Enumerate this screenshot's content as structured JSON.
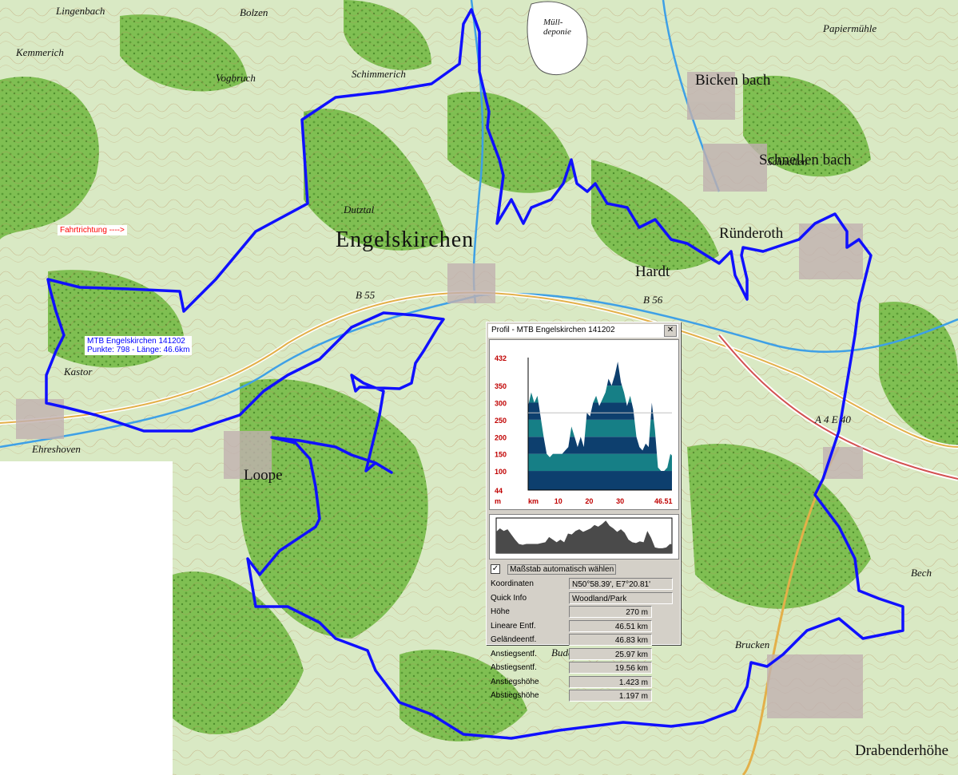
{
  "map": {
    "place_labels": [
      {
        "text": "Lingenbach",
        "cls": "lbl-sm"
      },
      {
        "text": "Bolzen",
        "cls": "lbl-sm"
      },
      {
        "text": "Müll-deponie",
        "cls": "lbl-sm"
      },
      {
        "text": "Papiermühle",
        "cls": "lbl-sm"
      },
      {
        "text": "Kemmerich",
        "cls": "lbl-sm"
      },
      {
        "text": "Vogbruch",
        "cls": "lbl-sm"
      },
      {
        "text": "Schimmerich",
        "cls": "lbl-sm"
      },
      {
        "text": "Bicken bach",
        "cls": "lbl-med"
      },
      {
        "text": "Schnellen bach",
        "cls": "lbl-med"
      },
      {
        "text": "Engelskirchen",
        "cls": "lbl-big"
      },
      {
        "text": "Ründeroth",
        "cls": "lbl-med"
      },
      {
        "text": "Hardt",
        "cls": "lbl-med"
      },
      {
        "text": "Dutztal",
        "cls": "lbl-sm"
      },
      {
        "text": "Loope",
        "cls": "lbl-med"
      },
      {
        "text": "Ehreshoven",
        "cls": "lbl-sm"
      },
      {
        "text": "Kastor",
        "cls": "lbl-sm"
      },
      {
        "text": "Brucken",
        "cls": "lbl-sm"
      },
      {
        "text": "Drabenderhöhe",
        "cls": "lbl-med"
      },
      {
        "text": "Buddelhagen",
        "cls": "lbl-sm"
      },
      {
        "text": "Bech",
        "cls": "lbl-sm"
      },
      {
        "text": "Schnellen",
        "cls": "lbl-sm"
      },
      {
        "text": "B 55",
        "cls": "lbl-sm"
      },
      {
        "text": "B 56",
        "cls": "lbl-sm"
      },
      {
        "text": "A 4 E 40",
        "cls": "lbl-sm"
      }
    ],
    "direction_label": "Fahrtrichtung ---->",
    "track_info_line1": "MTB Engelskirchen 141202",
    "track_info_line2": "Punkte: 798 - Länge: 46.6km",
    "track_color": "#1010ff"
  },
  "profile_window": {
    "title": "Profil - MTB Engelskirchen 141202",
    "close_label": "✕",
    "chart_data": {
      "type": "area",
      "y_ticks": [
        "432",
        "350",
        "300",
        "250",
        "200",
        "150",
        "100",
        "44"
      ],
      "y_unit": "m",
      "x_unit": "km",
      "x_ticks": [
        "10",
        "20",
        "30",
        "46.51"
      ],
      "ylim": [
        44,
        432
      ],
      "xlim": [
        0,
        46.51
      ],
      "guide_line": 270,
      "band_colors": [
        "#0d3f6e",
        "#167f86"
      ],
      "x": [
        0,
        1,
        2,
        3,
        4,
        5,
        6,
        7,
        8,
        9,
        10,
        11,
        12,
        13,
        14,
        15,
        16,
        17,
        18,
        19,
        20,
        21,
        22,
        23,
        24,
        25,
        26,
        27,
        28,
        29,
        30,
        31,
        32,
        33,
        34,
        35,
        36,
        37,
        38,
        39,
        40,
        41,
        42,
        43,
        44,
        45,
        46,
        46.51
      ],
      "values": [
        290,
        330,
        300,
        320,
        260,
        200,
        150,
        140,
        150,
        150,
        150,
        150,
        160,
        170,
        230,
        200,
        170,
        200,
        170,
        270,
        260,
        300,
        320,
        290,
        310,
        330,
        370,
        350,
        380,
        420,
        360,
        330,
        290,
        320,
        280,
        200,
        170,
        160,
        180,
        170,
        300,
        220,
        110,
        100,
        100,
        110,
        150,
        145
      ]
    },
    "checkbox": {
      "checked_mark": "✓",
      "label": "Maßstab automatisch wählen"
    },
    "fields": [
      {
        "key": "Koordinaten",
        "value": "N50°58.39', E7°20.81'",
        "align": "l"
      },
      {
        "key": "Quick Info",
        "value": "Woodland/Park",
        "align": "l"
      },
      {
        "key": "Höhe",
        "value": "270 m",
        "align": "r"
      },
      {
        "key": "Lineare Entf.",
        "value": "46.51 km",
        "align": "r"
      },
      {
        "key": "Geländeentf.",
        "value": "46.83 km",
        "align": "r"
      },
      {
        "key": "Anstiegsentf.",
        "value": "25.97 km",
        "align": "r"
      },
      {
        "key": "Abstiegsentf.",
        "value": "19.56 km",
        "align": "r"
      },
      {
        "key": "Anstiegshöhe",
        "value": "1.423 m",
        "align": "r"
      },
      {
        "key": "Abstiegshöhe",
        "value": "1.197 m",
        "align": "r"
      }
    ]
  }
}
